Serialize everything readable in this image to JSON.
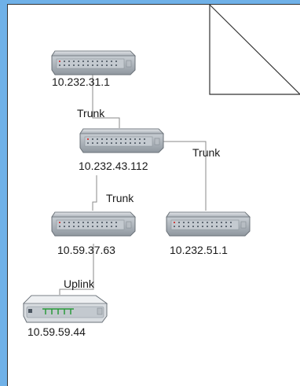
{
  "diagram": {
    "devices": [
      {
        "id": "sw-top",
        "ip": "10.232.31.1",
        "icon": "network-switch-icon"
      },
      {
        "id": "sw-core",
        "ip": "10.232.43.112",
        "icon": "network-switch-icon"
      },
      {
        "id": "sw-left",
        "ip": "10.59.37.63",
        "icon": "network-switch-icon"
      },
      {
        "id": "sw-right",
        "ip": "10.232.51.1",
        "icon": "network-switch-icon"
      },
      {
        "id": "router",
        "ip": "10.59.59.44",
        "icon": "router-icon"
      }
    ],
    "links": [
      {
        "from": "sw-top",
        "to": "sw-core",
        "label": "Trunk"
      },
      {
        "from": "sw-core",
        "to": "sw-right",
        "label": "Trunk"
      },
      {
        "from": "sw-core",
        "to": "sw-left",
        "label": "Trunk"
      },
      {
        "from": "sw-left",
        "to": "router",
        "label": "Uplink"
      }
    ]
  },
  "colors": {
    "background": "#6fb1e8",
    "page": "#ffffff",
    "line": "#808080"
  }
}
